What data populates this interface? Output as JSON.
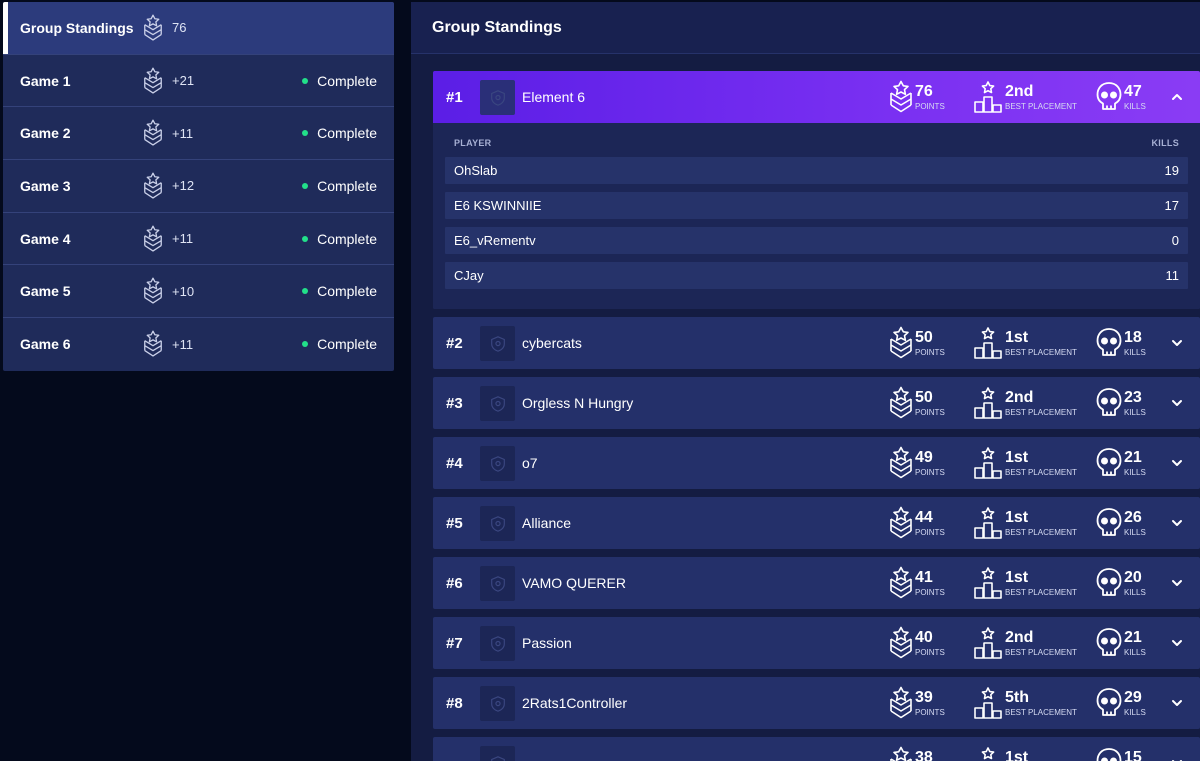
{
  "sidebar": {
    "items": [
      {
        "label": "Group Standings",
        "points": "76",
        "status": "",
        "active": true
      },
      {
        "label": "Game 1",
        "points": "+21",
        "status": "Complete"
      },
      {
        "label": "Game 2",
        "points": "+11",
        "status": "Complete"
      },
      {
        "label": "Game 3",
        "points": "+12",
        "status": "Complete"
      },
      {
        "label": "Game 4",
        "points": "+11",
        "status": "Complete"
      },
      {
        "label": "Game 5",
        "points": "+10",
        "status": "Complete"
      },
      {
        "label": "Game 6",
        "points": "+11",
        "status": "Complete"
      }
    ],
    "icon": "chevron-rank-icon"
  },
  "main": {
    "title": "Group Standings",
    "labels": {
      "points": "POINTS",
      "placement": "BEST PLACEMENT",
      "kills": "KILLS",
      "player_col": "PLAYER",
      "kills_col": "KILLS"
    },
    "teams": [
      {
        "rank": "#1",
        "name": "Element 6",
        "points": "76",
        "placement": "2nd",
        "kills": "47",
        "expanded": true,
        "players": [
          {
            "name": "OhSlab",
            "kills": "19"
          },
          {
            "name": "E6 KSWINNIIE",
            "kills": "17"
          },
          {
            "name": "E6_vRementv",
            "kills": "0"
          },
          {
            "name": "CJay",
            "kills": "11"
          }
        ]
      },
      {
        "rank": "#2",
        "name": "cybercats",
        "points": "50",
        "placement": "1st",
        "kills": "18"
      },
      {
        "rank": "#3",
        "name": "Orgless N Hungry",
        "points": "50",
        "placement": "2nd",
        "kills": "23"
      },
      {
        "rank": "#4",
        "name": "o7",
        "points": "49",
        "placement": "1st",
        "kills": "21"
      },
      {
        "rank": "#5",
        "name": "Alliance",
        "points": "44",
        "placement": "1st",
        "kills": "26"
      },
      {
        "rank": "#6",
        "name": "VAMO QUERER",
        "points": "41",
        "placement": "1st",
        "kills": "20"
      },
      {
        "rank": "#7",
        "name": "Passion",
        "points": "40",
        "placement": "2nd",
        "kills": "21"
      },
      {
        "rank": "#8",
        "name": "2Rats1Controller",
        "points": "39",
        "placement": "5th",
        "kills": "29"
      },
      {
        "rank": "",
        "name": "",
        "points": "38",
        "placement": "1st",
        "kills": "15"
      }
    ]
  },
  "colors": {
    "accent": "#7a30f2",
    "status_complete": "#22e08a",
    "panel": "#24306a",
    "background": "#040a1c"
  }
}
